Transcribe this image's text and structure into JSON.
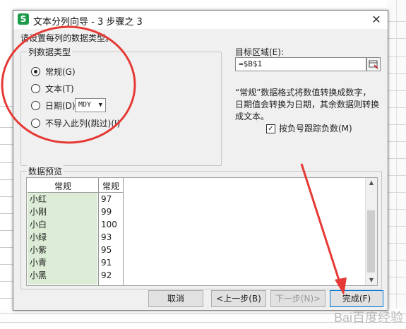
{
  "dialog": {
    "title": "文本分列向导 - 3 步骤之 3",
    "app_icon_text": "S",
    "close_label": "✕",
    "instruction": "请设置每列的数据类型。"
  },
  "column_type": {
    "group_title": "列数据类型",
    "options": [
      {
        "label": "常规(G)",
        "checked": true
      },
      {
        "label": "文本(T)",
        "checked": false
      },
      {
        "label": "日期(D)",
        "checked": false
      },
      {
        "label": "不导入此列(跳过)(I)",
        "checked": false
      }
    ],
    "date_format": "MDY",
    "dropdown_arrow": "▼"
  },
  "destination": {
    "label": "目标区域(E):",
    "value": "=$B$1"
  },
  "description": [
    "“常规”数据格式将数值转换成数字，",
    "日期值会转换为日期，其余数据则转换",
    "成文本。"
  ],
  "negative_option": {
    "label": "按负号跟踪负数(M)",
    "checked": true,
    "check_mark": "✓"
  },
  "preview": {
    "title": "数据预览",
    "headers": [
      "常规",
      "常规"
    ],
    "rows": [
      [
        "小红",
        "97"
      ],
      [
        "小刚",
        "99"
      ],
      [
        "小白",
        "100"
      ],
      [
        "小绿",
        "93"
      ],
      [
        "小紫",
        "95"
      ],
      [
        "小青",
        "91"
      ],
      [
        "小黑",
        "92"
      ]
    ],
    "scroll_up": "▲",
    "scroll_down": "▼"
  },
  "buttons": {
    "cancel": "取消",
    "back": "<上一步(B)",
    "next": "下一步(N)>",
    "finish": "完成(F)"
  },
  "colors": {
    "highlight_column": "#dcecd6",
    "annotation": "#e53935"
  },
  "watermark": "Bai百度经验"
}
